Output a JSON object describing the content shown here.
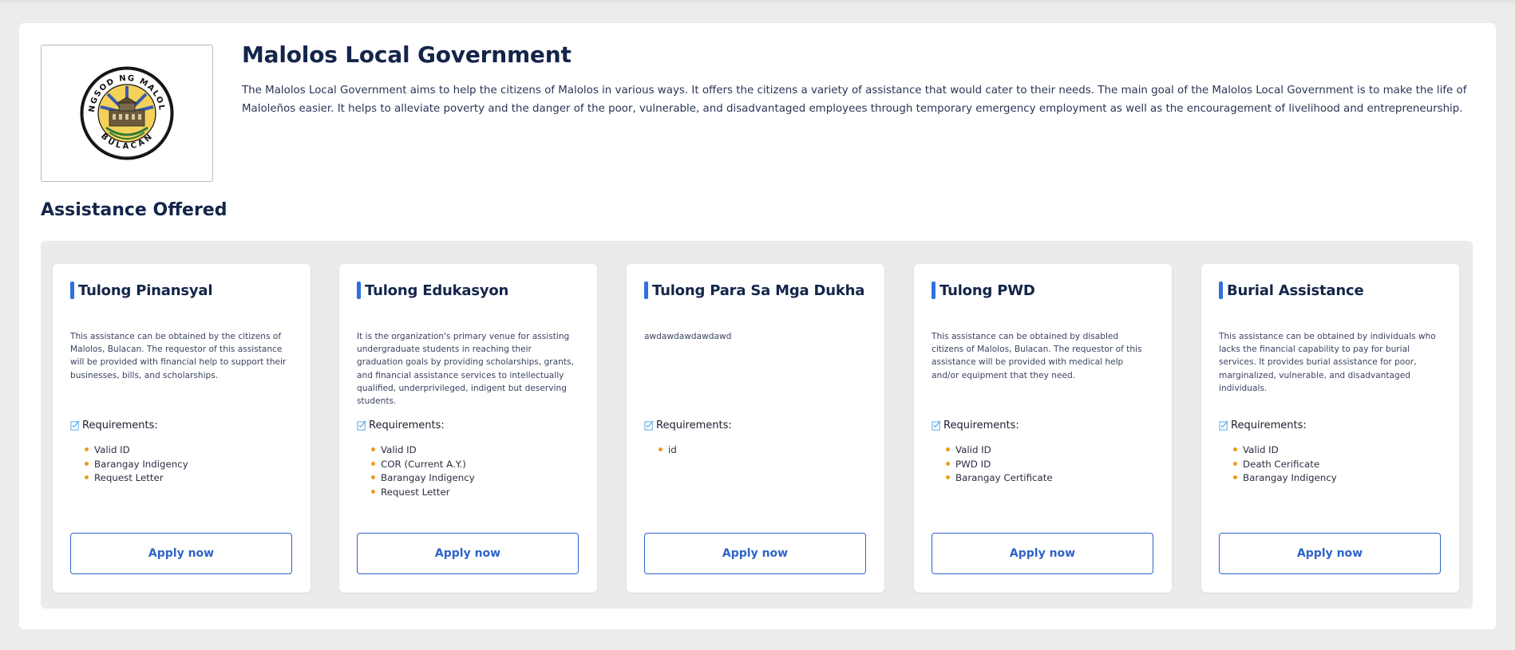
{
  "org": {
    "logo_text_top": "LUNGSOD NG MALOLOS",
    "logo_text_bottom": "BULACAN",
    "title": "Malolos Local Government",
    "description": "The Malolos Local Government aims to help the citizens of Malolos in various ways. It offers the citizens a variety of assistance that would cater to their needs. The main goal of the Malolos Local Government is to make the life of Maloleños easier. It helps to alleviate poverty and the danger of the poor, vulnerable, and disadvantaged employees through temporary emergency employment as well as the encouragement of livelihood and entrepreneurship."
  },
  "section": {
    "title": "Assistance Offered"
  },
  "colors": {
    "accent": "#2f6fe0",
    "bullet": "#f29a1a",
    "heading": "#14254a"
  },
  "cards": [
    {
      "title": "Tulong Pinansyal",
      "description": "This assistance can be obtained by the citizens of Malolos, Bulacan. The requestor of this assistance will be provided with financial help to support their businesses, bills, and scholarships.",
      "requirements_label": "Requirements:",
      "requirements": [
        "Valid ID",
        "Barangay Indigency",
        "Request Letter"
      ],
      "button": "Apply now"
    },
    {
      "title": "Tulong Edukasyon",
      "description": "It is the organization's primary venue for assisting undergraduate students in reaching their graduation goals by providing scholarships, grants, and financial assistance services to intellectually qualified, underprivileged, indigent but deserving students.",
      "requirements_label": "Requirements:",
      "requirements": [
        "Valid ID",
        "COR (Current A.Y.)",
        "Barangay Indigency",
        "Request Letter"
      ],
      "button": "Apply now"
    },
    {
      "title": "Tulong Para Sa Mga Dukha",
      "description": "awdawdawdawdawd",
      "requirements_label": "Requirements:",
      "requirements": [
        "id"
      ],
      "button": "Apply now"
    },
    {
      "title": "Tulong PWD",
      "description": "This assistance can be obtained by disabled citizens of Malolos, Bulacan. The requestor of this assistance will be provided with medical help and/or equipment that they need.",
      "requirements_label": "Requirements:",
      "requirements": [
        "Valid ID",
        "PWD ID",
        "Barangay Certificate"
      ],
      "button": "Apply now"
    },
    {
      "title": "Burial Assistance",
      "description": "This assistance can be obtained by individuals who lacks the financial capability to pay for burial services. It provides burial assistance for poor, marginalized, vulnerable, and disadvantaged individuals.",
      "requirements_label": "Requirements:",
      "requirements": [
        "Valid ID",
        "Death Cerificate",
        "Barangay Indigency"
      ],
      "button": "Apply now"
    }
  ]
}
